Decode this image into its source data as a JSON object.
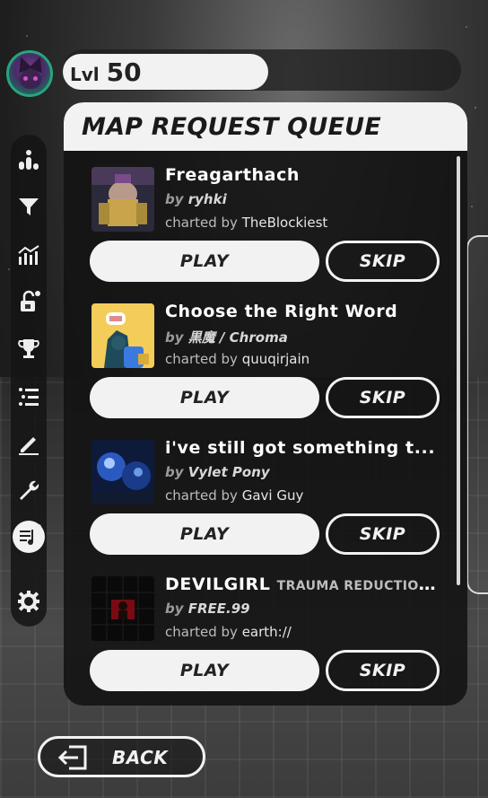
{
  "header": {
    "level_label": "Lvl",
    "level_value": "50"
  },
  "panel": {
    "title": "MAP REQUEST QUEUE"
  },
  "queue": [
    {
      "title": "Freagarthach",
      "subtitle": "",
      "by_prefix": "by",
      "artist": "ryhki",
      "charted_prefix": "charted by",
      "charter": "TheBlockiest",
      "play_label": "PLAY",
      "skip_label": "SKIP"
    },
    {
      "title": "Choose the Right Word",
      "subtitle": "",
      "by_prefix": "by",
      "artist": "黒魔 / Chroma",
      "charted_prefix": "charted by",
      "charter": "quuqirjain",
      "play_label": "PLAY",
      "skip_label": "SKIP"
    },
    {
      "title": "i've still got something t...",
      "subtitle": "",
      "by_prefix": "by",
      "artist": "Vylet Pony",
      "charted_prefix": "charted by",
      "charter": "Gavi Guy",
      "play_label": "PLAY",
      "skip_label": "SKIP"
    },
    {
      "title": "DEVILGIRL",
      "subtitle": "TRAUMA REDUCTION...",
      "by_prefix": "by",
      "artist": "FREE.99",
      "charted_prefix": "charted by",
      "charter": "earth://",
      "play_label": "PLAY",
      "skip_label": "SKIP"
    }
  ],
  "footer": {
    "back_label": "BACK"
  },
  "sidebar": {
    "items": [
      {
        "icon": "leaderboard-icon"
      },
      {
        "icon": "filter-icon"
      },
      {
        "icon": "stats-icon"
      },
      {
        "icon": "unlock-icon"
      },
      {
        "icon": "trophy-icon"
      },
      {
        "icon": "list-icon"
      },
      {
        "icon": "edit-icon"
      },
      {
        "icon": "wrench-icon"
      },
      {
        "icon": "music-queue-icon",
        "active": true
      },
      {
        "icon": "gear-icon"
      }
    ]
  },
  "colors": {
    "panel_bg": "#121212",
    "button_fill": "#f2f2f2",
    "text_dark": "#1a1a1a"
  }
}
